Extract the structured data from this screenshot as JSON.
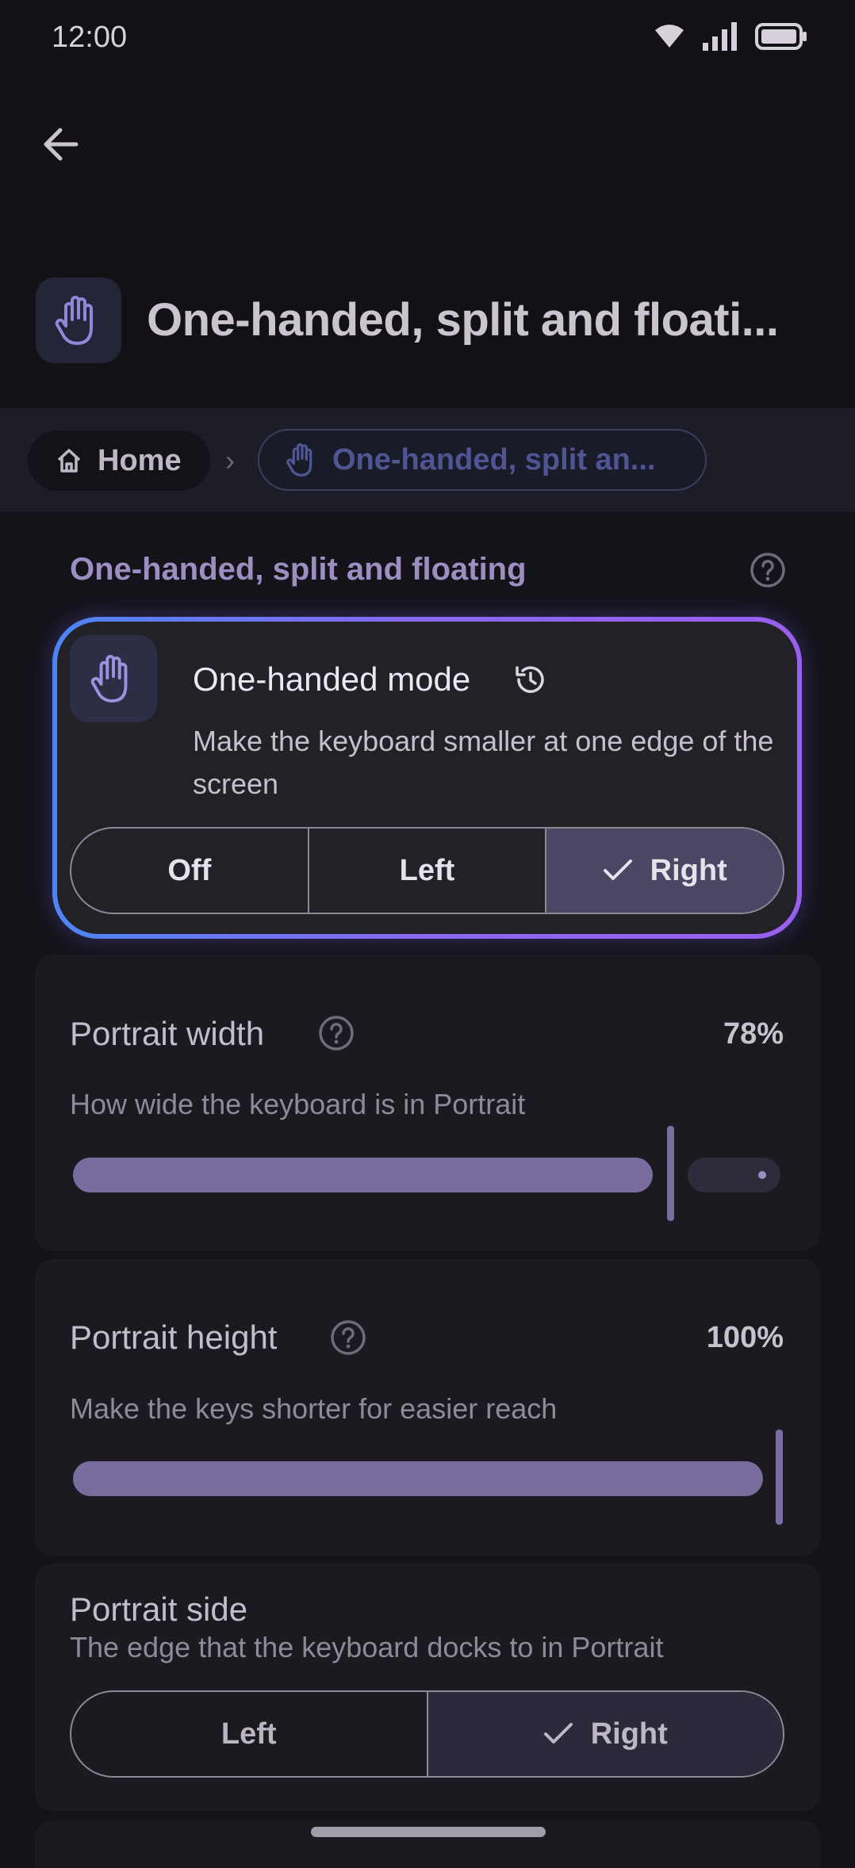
{
  "status_bar": {
    "time": "12:00"
  },
  "header": {
    "title": "One-handed, split and floati..."
  },
  "breadcrumb": {
    "home": "Home",
    "separator": "›",
    "current": "One-handed, split an..."
  },
  "section": {
    "title": "One-handed, split and floating"
  },
  "one_handed_mode": {
    "title": "One-handed mode",
    "description": "Make the keyboard smaller at one edge of the screen",
    "options": [
      "Off",
      "Left",
      "Right"
    ],
    "selected": "Right"
  },
  "portrait_width": {
    "label": "Portrait width",
    "value": "78%",
    "description": "How wide the keyboard is in Portrait",
    "fraction": 0.78
  },
  "portrait_height": {
    "label": "Portrait height",
    "value": "100%",
    "description": "Make the keys shorter for easier reach",
    "fraction": 1.0
  },
  "portrait_side": {
    "label": "Portrait side",
    "description": "The edge that the keyboard docks to in Portrait",
    "options": [
      "Left",
      "Right"
    ],
    "selected": "Right"
  },
  "colors": {
    "accent": "#786d9c",
    "highlight_start": "#4d85f5",
    "highlight_end": "#9a5ff0"
  },
  "icons": [
    "wifi-icon",
    "signal-icon",
    "battery-icon",
    "back-arrow-icon",
    "hand-icon",
    "home-icon",
    "help-icon",
    "history-icon",
    "check-icon"
  ]
}
